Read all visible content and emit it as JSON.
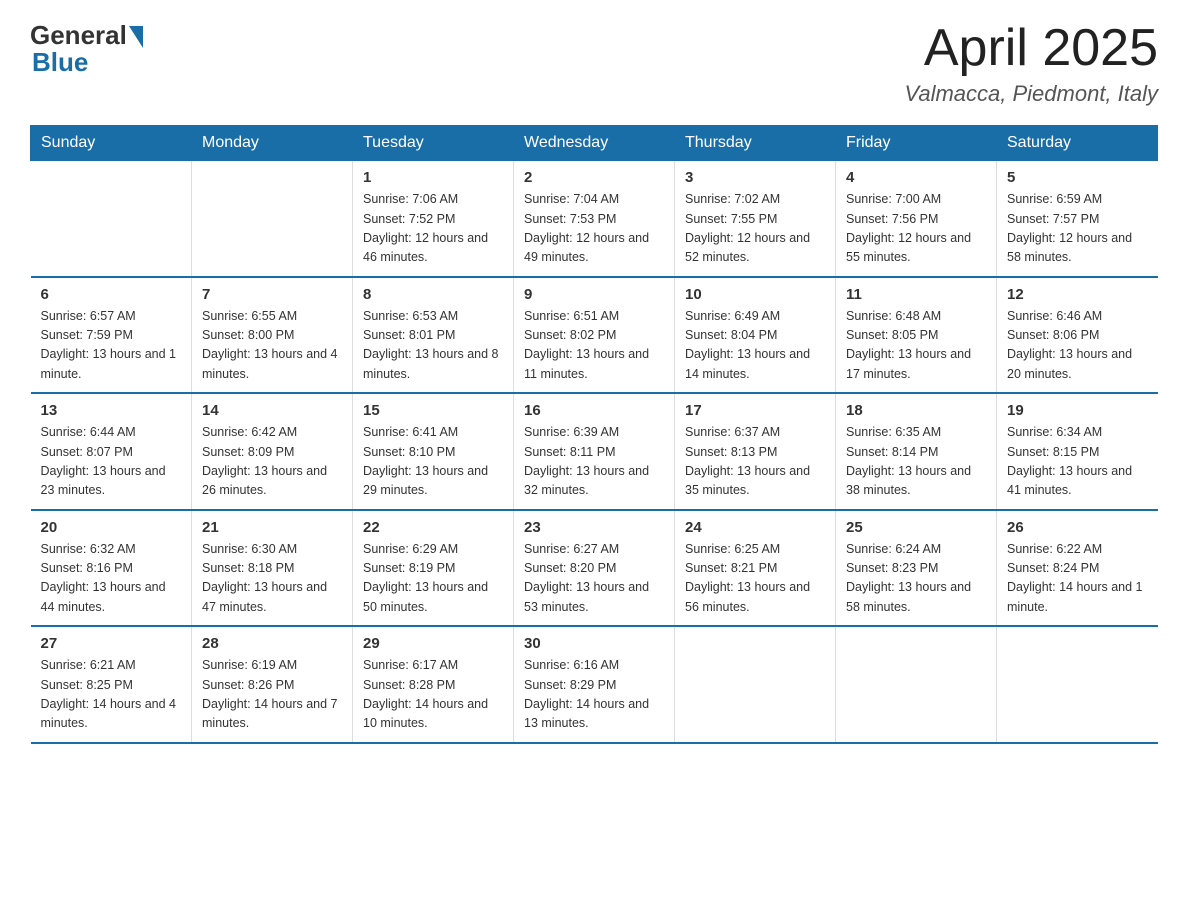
{
  "header": {
    "logo_general": "General",
    "logo_blue": "Blue",
    "title": "April 2025",
    "location": "Valmacca, Piedmont, Italy"
  },
  "days_of_week": [
    "Sunday",
    "Monday",
    "Tuesday",
    "Wednesday",
    "Thursday",
    "Friday",
    "Saturday"
  ],
  "weeks": [
    [
      {
        "day": "",
        "info": ""
      },
      {
        "day": "",
        "info": ""
      },
      {
        "day": "1",
        "info": "Sunrise: 7:06 AM\nSunset: 7:52 PM\nDaylight: 12 hours\nand 46 minutes."
      },
      {
        "day": "2",
        "info": "Sunrise: 7:04 AM\nSunset: 7:53 PM\nDaylight: 12 hours\nand 49 minutes."
      },
      {
        "day": "3",
        "info": "Sunrise: 7:02 AM\nSunset: 7:55 PM\nDaylight: 12 hours\nand 52 minutes."
      },
      {
        "day": "4",
        "info": "Sunrise: 7:00 AM\nSunset: 7:56 PM\nDaylight: 12 hours\nand 55 minutes."
      },
      {
        "day": "5",
        "info": "Sunrise: 6:59 AM\nSunset: 7:57 PM\nDaylight: 12 hours\nand 58 minutes."
      }
    ],
    [
      {
        "day": "6",
        "info": "Sunrise: 6:57 AM\nSunset: 7:59 PM\nDaylight: 13 hours\nand 1 minute."
      },
      {
        "day": "7",
        "info": "Sunrise: 6:55 AM\nSunset: 8:00 PM\nDaylight: 13 hours\nand 4 minutes."
      },
      {
        "day": "8",
        "info": "Sunrise: 6:53 AM\nSunset: 8:01 PM\nDaylight: 13 hours\nand 8 minutes."
      },
      {
        "day": "9",
        "info": "Sunrise: 6:51 AM\nSunset: 8:02 PM\nDaylight: 13 hours\nand 11 minutes."
      },
      {
        "day": "10",
        "info": "Sunrise: 6:49 AM\nSunset: 8:04 PM\nDaylight: 13 hours\nand 14 minutes."
      },
      {
        "day": "11",
        "info": "Sunrise: 6:48 AM\nSunset: 8:05 PM\nDaylight: 13 hours\nand 17 minutes."
      },
      {
        "day": "12",
        "info": "Sunrise: 6:46 AM\nSunset: 8:06 PM\nDaylight: 13 hours\nand 20 minutes."
      }
    ],
    [
      {
        "day": "13",
        "info": "Sunrise: 6:44 AM\nSunset: 8:07 PM\nDaylight: 13 hours\nand 23 minutes."
      },
      {
        "day": "14",
        "info": "Sunrise: 6:42 AM\nSunset: 8:09 PM\nDaylight: 13 hours\nand 26 minutes."
      },
      {
        "day": "15",
        "info": "Sunrise: 6:41 AM\nSunset: 8:10 PM\nDaylight: 13 hours\nand 29 minutes."
      },
      {
        "day": "16",
        "info": "Sunrise: 6:39 AM\nSunset: 8:11 PM\nDaylight: 13 hours\nand 32 minutes."
      },
      {
        "day": "17",
        "info": "Sunrise: 6:37 AM\nSunset: 8:13 PM\nDaylight: 13 hours\nand 35 minutes."
      },
      {
        "day": "18",
        "info": "Sunrise: 6:35 AM\nSunset: 8:14 PM\nDaylight: 13 hours\nand 38 minutes."
      },
      {
        "day": "19",
        "info": "Sunrise: 6:34 AM\nSunset: 8:15 PM\nDaylight: 13 hours\nand 41 minutes."
      }
    ],
    [
      {
        "day": "20",
        "info": "Sunrise: 6:32 AM\nSunset: 8:16 PM\nDaylight: 13 hours\nand 44 minutes."
      },
      {
        "day": "21",
        "info": "Sunrise: 6:30 AM\nSunset: 8:18 PM\nDaylight: 13 hours\nand 47 minutes."
      },
      {
        "day": "22",
        "info": "Sunrise: 6:29 AM\nSunset: 8:19 PM\nDaylight: 13 hours\nand 50 minutes."
      },
      {
        "day": "23",
        "info": "Sunrise: 6:27 AM\nSunset: 8:20 PM\nDaylight: 13 hours\nand 53 minutes."
      },
      {
        "day": "24",
        "info": "Sunrise: 6:25 AM\nSunset: 8:21 PM\nDaylight: 13 hours\nand 56 minutes."
      },
      {
        "day": "25",
        "info": "Sunrise: 6:24 AM\nSunset: 8:23 PM\nDaylight: 13 hours\nand 58 minutes."
      },
      {
        "day": "26",
        "info": "Sunrise: 6:22 AM\nSunset: 8:24 PM\nDaylight: 14 hours\nand 1 minute."
      }
    ],
    [
      {
        "day": "27",
        "info": "Sunrise: 6:21 AM\nSunset: 8:25 PM\nDaylight: 14 hours\nand 4 minutes."
      },
      {
        "day": "28",
        "info": "Sunrise: 6:19 AM\nSunset: 8:26 PM\nDaylight: 14 hours\nand 7 minutes."
      },
      {
        "day": "29",
        "info": "Sunrise: 6:17 AM\nSunset: 8:28 PM\nDaylight: 14 hours\nand 10 minutes."
      },
      {
        "day": "30",
        "info": "Sunrise: 6:16 AM\nSunset: 8:29 PM\nDaylight: 14 hours\nand 13 minutes."
      },
      {
        "day": "",
        "info": ""
      },
      {
        "day": "",
        "info": ""
      },
      {
        "day": "",
        "info": ""
      }
    ]
  ]
}
